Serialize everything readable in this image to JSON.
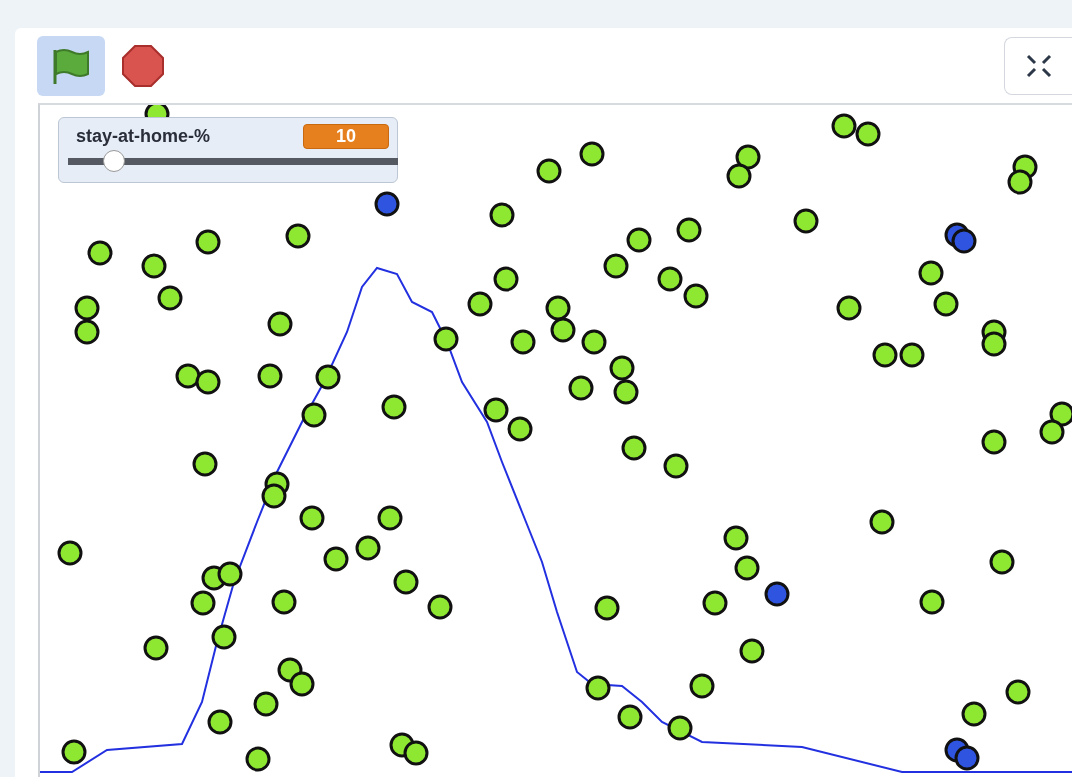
{
  "toolbar": {
    "green_flag": {
      "selected": true
    }
  },
  "monitor": {
    "label": "stay-at-home-%",
    "value": "10",
    "level": 0.14
  }
}
